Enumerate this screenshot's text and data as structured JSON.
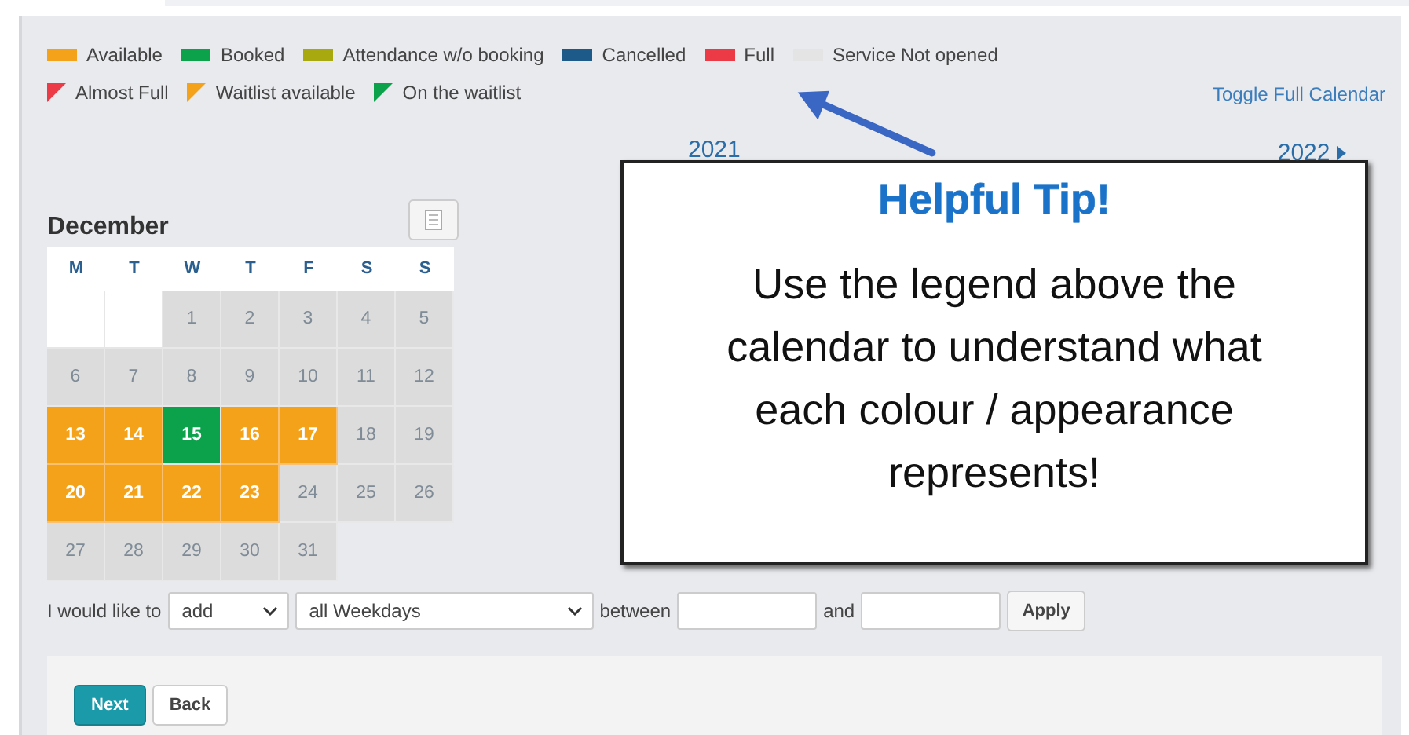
{
  "legend": [
    {
      "kind": "swatch",
      "color": "#f5a21b",
      "label": "Available"
    },
    {
      "kind": "swatch",
      "color": "#0ca14b",
      "label": "Booked"
    },
    {
      "kind": "swatch",
      "color": "#a8a80f",
      "label": "Attendance w/o booking"
    },
    {
      "kind": "swatch",
      "color": "#1d5a8a",
      "label": "Cancelled"
    },
    {
      "kind": "swatch",
      "color": "#ec3a46",
      "label": "Full"
    },
    {
      "kind": "swatch",
      "color": "#e4e4e4",
      "label": "Service Not opened"
    },
    {
      "kind": "corner",
      "color": "#ec3a46",
      "label": "Almost Full"
    },
    {
      "kind": "corner",
      "color": "#f5a21b",
      "label": "Waitlist available"
    },
    {
      "kind": "corner",
      "color": "#0ca14b",
      "label": "On the waitlist"
    }
  ],
  "toggle_link": "Toggle Full Calendar",
  "year_prev": "2021",
  "year_next": "2022",
  "calendar": {
    "month": "December",
    "weekdays": [
      "M",
      "T",
      "W",
      "T",
      "F",
      "S",
      "S"
    ],
    "weeks": [
      [
        {
          "kind": "blank"
        },
        {
          "kind": "blank"
        },
        {
          "kind": "closed",
          "day": "1"
        },
        {
          "kind": "closed",
          "day": "2"
        },
        {
          "kind": "closed",
          "day": "3"
        },
        {
          "kind": "closed",
          "day": "4"
        },
        {
          "kind": "closed",
          "day": "5"
        }
      ],
      [
        {
          "kind": "closed",
          "day": "6"
        },
        {
          "kind": "closed",
          "day": "7"
        },
        {
          "kind": "closed",
          "day": "8"
        },
        {
          "kind": "closed",
          "day": "9"
        },
        {
          "kind": "closed",
          "day": "10"
        },
        {
          "kind": "closed",
          "day": "11"
        },
        {
          "kind": "closed",
          "day": "12"
        }
      ],
      [
        {
          "kind": "available",
          "day": "13"
        },
        {
          "kind": "available",
          "day": "14"
        },
        {
          "kind": "booked",
          "day": "15"
        },
        {
          "kind": "available",
          "day": "16"
        },
        {
          "kind": "available",
          "day": "17"
        },
        {
          "kind": "closed",
          "day": "18"
        },
        {
          "kind": "closed",
          "day": "19"
        }
      ],
      [
        {
          "kind": "available",
          "day": "20"
        },
        {
          "kind": "available",
          "day": "21"
        },
        {
          "kind": "available",
          "day": "22"
        },
        {
          "kind": "available",
          "day": "23"
        },
        {
          "kind": "closed",
          "day": "24"
        },
        {
          "kind": "closed",
          "day": "25"
        },
        {
          "kind": "closed",
          "day": "26"
        }
      ],
      [
        {
          "kind": "closed",
          "day": "27"
        },
        {
          "kind": "closed",
          "day": "28"
        },
        {
          "kind": "closed",
          "day": "29"
        },
        {
          "kind": "closed",
          "day": "30"
        },
        {
          "kind": "closed",
          "day": "31"
        }
      ]
    ]
  },
  "tip": {
    "title": "Helpful Tip!",
    "body": "Use the legend above the calendar to understand what each colour / appearance represents!"
  },
  "form": {
    "prefix": "I would like to",
    "action": "add",
    "days": "all Weekdays",
    "between": "between",
    "and": "and",
    "apply": "Apply"
  },
  "buttons": {
    "next": "Next",
    "back": "Back"
  }
}
